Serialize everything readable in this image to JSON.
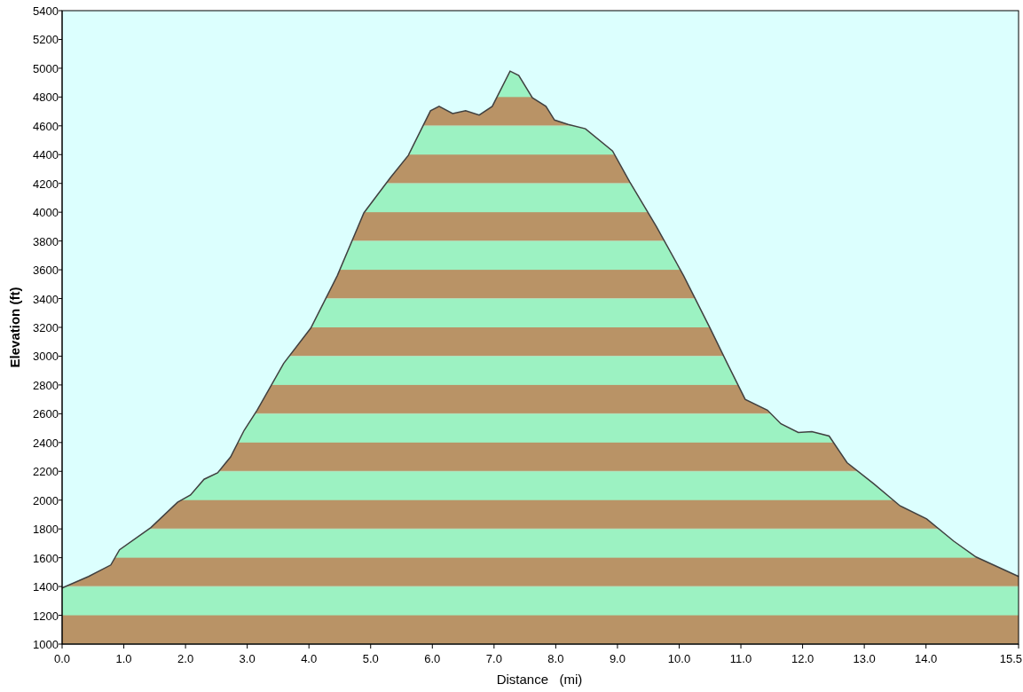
{
  "chart": {
    "chart_data": {
      "type": "area",
      "xlabel": "Distance   (mi)",
      "ylabel": "Elevation (ft)",
      "x": [
        0,
        0.43,
        0.79,
        0.93,
        1.44,
        1.87,
        2.08,
        2.3,
        2.52,
        2.73,
        2.95,
        3.16,
        3.59,
        4.03,
        4.46,
        4.89,
        5.32,
        5.61,
        5.97,
        6.11,
        6.33,
        6.54,
        6.76,
        6.97,
        7.26,
        7.4,
        7.62,
        7.84,
        7.98,
        8.2,
        8.48,
        8.92,
        9.2,
        9.63,
        10.07,
        10.5,
        10.78,
        11.07,
        11.43,
        11.65,
        11.93,
        12.15,
        12.43,
        12.72,
        13.15,
        13.58,
        14.01,
        14.45,
        14.81,
        15.5
      ],
      "series": [
        {
          "color": "#404040",
          "values": [
            1390,
            1470,
            1550,
            1655,
            1810,
            1985,
            2035,
            2145,
            2190,
            2300,
            2485,
            2625,
            2950,
            3195,
            3560,
            3995,
            4240,
            4395,
            4705,
            4735,
            4685,
            4705,
            4675,
            4735,
            4980,
            4950,
            4795,
            4735,
            4640,
            4610,
            4580,
            4425,
            4210,
            3900,
            3560,
            3195,
            2950,
            2700,
            2625,
            2530,
            2470,
            2475,
            2445,
            2260,
            2115,
            1960,
            1870,
            1715,
            1605,
            1470
          ]
        }
      ],
      "xlim": [
        0,
        15.5
      ],
      "ylim": [
        1000,
        5400
      ],
      "xticks": [
        {
          "value": 0,
          "label": "0.0"
        },
        {
          "value": 1,
          "label": "1.0"
        },
        {
          "value": 2,
          "label": "2.0"
        },
        {
          "value": 3,
          "label": "3.0"
        },
        {
          "value": 4,
          "label": "4.0"
        },
        {
          "value": 5,
          "label": "5.0"
        },
        {
          "value": 6,
          "label": "6.0"
        },
        {
          "value": 7,
          "label": "7.0"
        },
        {
          "value": 8,
          "label": "8.0"
        },
        {
          "value": 9,
          "label": "9.0"
        },
        {
          "value": 10,
          "label": "10.0"
        },
        {
          "value": 11,
          "label": "11.0"
        },
        {
          "value": 12,
          "label": "12.0"
        },
        {
          "value": 13,
          "label": "13.0"
        },
        {
          "value": 14,
          "label": "14.0"
        },
        {
          "value": 15.5,
          "label": "15.5"
        }
      ],
      "yticks": [
        1000,
        1200,
        1400,
        1600,
        1800,
        2000,
        2200,
        2400,
        2600,
        2800,
        3000,
        3200,
        3400,
        3600,
        3800,
        4000,
        4200,
        4400,
        4600,
        4800,
        5000,
        5200,
        5400
      ]
    }
  }
}
